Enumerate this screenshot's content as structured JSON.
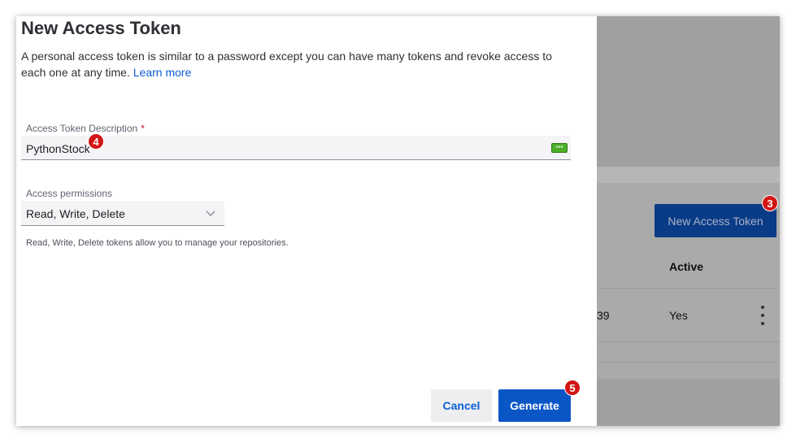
{
  "dialog": {
    "title": "New Access Token",
    "description": "A personal access token is similar to a password except you can have many tokens and revoke access to each one at any time.",
    "learn_more": "Learn more",
    "token_description": {
      "label": "Access Token Description",
      "required_mark": "*",
      "value": "PythonStock",
      "password_manager_icon": "key-dots-icon"
    },
    "permissions": {
      "label": "Access permissions",
      "value": "Read, Write, Delete",
      "help": "Read, Write, Delete tokens allow you to manage your repositories."
    },
    "cancel_label": "Cancel",
    "generate_label": "Generate"
  },
  "background": {
    "new_token_button": "New Access Token",
    "active_header": "Active",
    "row_partial_text": "39",
    "row_active_value": "Yes"
  },
  "annotations": {
    "step_3": "3",
    "step_4": "4",
    "step_5": "5"
  },
  "colors": {
    "accent": "#0b56c7",
    "link": "#0b5ed7",
    "badge": "#d31515"
  }
}
